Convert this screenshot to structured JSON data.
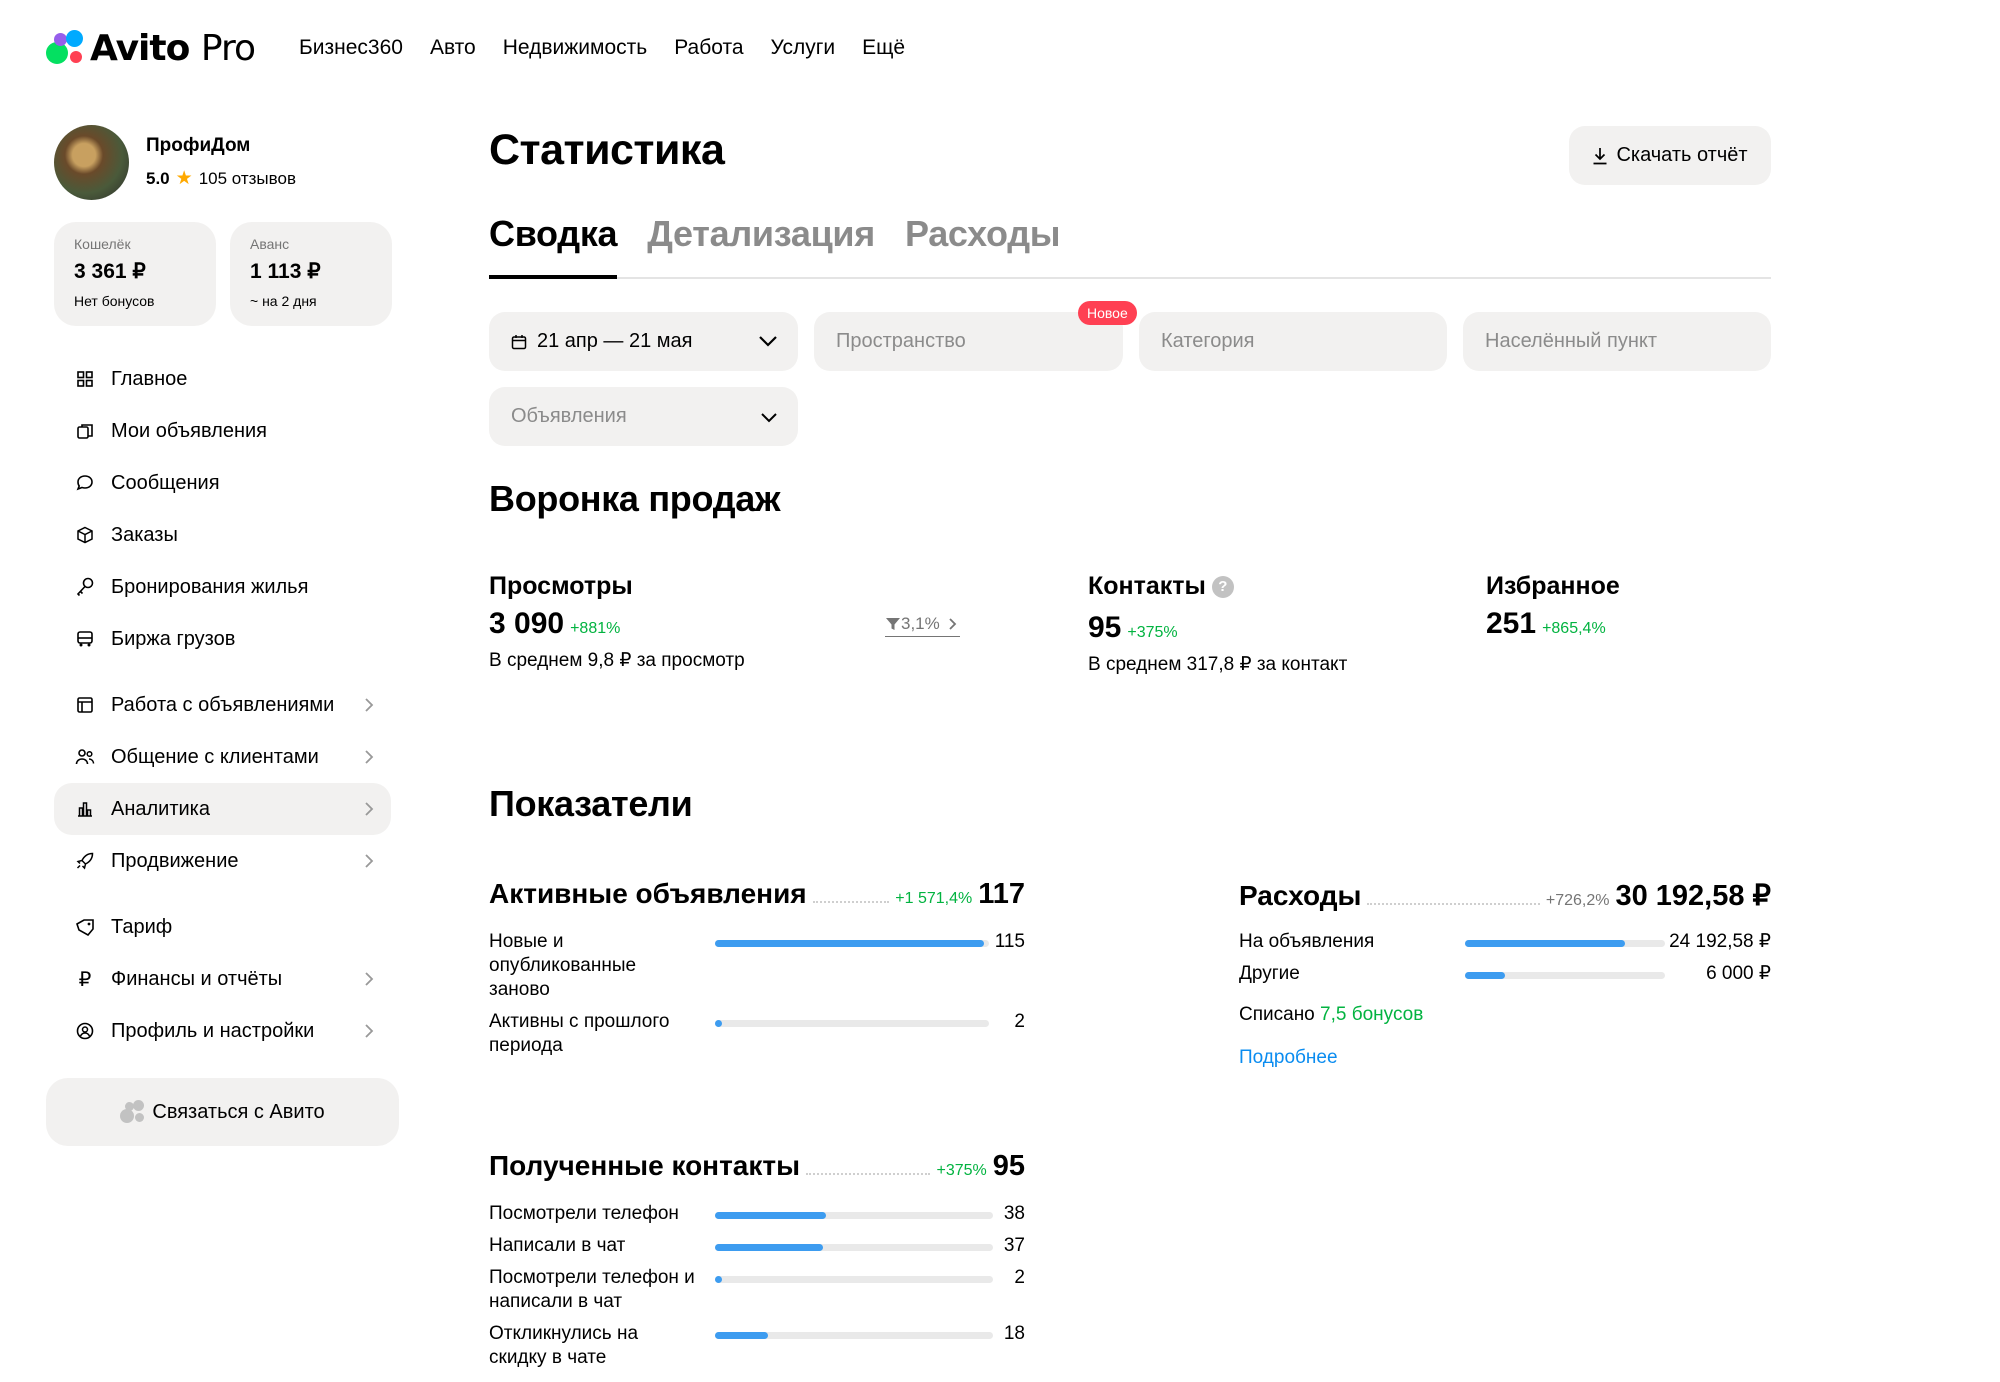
{
  "brand": {
    "name": "Avito",
    "suffix": "Pro"
  },
  "top_nav": [
    "Бизнес360",
    "Авто",
    "Недвижимость",
    "Работа",
    "Услуги",
    "Ещё"
  ],
  "profile": {
    "name": "ПрофиДом",
    "rating": "5.0",
    "reviews": "105 отзывов"
  },
  "wallets": [
    {
      "label": "Кошелёк",
      "value": "3 361 ₽",
      "sub": "Нет бонусов"
    },
    {
      "label": "Аванс",
      "value": "1 113 ₽",
      "sub": "~ на 2 дня"
    }
  ],
  "menu": [
    {
      "label": "Главное",
      "icon": "grid-icon"
    },
    {
      "label": "Мои объявления",
      "icon": "copy-icon"
    },
    {
      "label": "Сообщения",
      "icon": "chat-icon"
    },
    {
      "label": "Заказы",
      "icon": "box-icon"
    },
    {
      "label": "Бронирования жилья",
      "icon": "key-icon"
    },
    {
      "label": "Биржа грузов",
      "icon": "truck-icon"
    },
    {
      "label": "Работа с объявлениями",
      "icon": "list-icon",
      "chevron": true
    },
    {
      "label": "Общение с клиентами",
      "icon": "users-icon",
      "chevron": true
    },
    {
      "label": "Аналитика",
      "icon": "bar-chart-icon",
      "chevron": true,
      "active": true
    },
    {
      "label": "Продвижение",
      "icon": "rocket-icon",
      "chevron": true
    },
    {
      "label": "Тариф",
      "icon": "tag-icon"
    },
    {
      "label": "Финансы и отчёты",
      "icon": "ruble-icon",
      "chevron": true
    },
    {
      "label": "Профиль и настройки",
      "icon": "user-circle-icon",
      "chevron": true
    }
  ],
  "contact_button": "Связаться с Авито",
  "page": {
    "title": "Статистика",
    "download": "Скачать отчёт",
    "tabs": [
      "Сводка",
      "Детализация",
      "Расходы"
    ]
  },
  "filters": {
    "date": "21 апр — 21 мая",
    "space": "Пространство",
    "space_badge": "Новое",
    "category": "Категория",
    "location": "Населённый пункт",
    "ads": "Объявления"
  },
  "funnel": {
    "title": "Воронка продаж",
    "views": {
      "title": "Просмотры",
      "value": "3 090",
      "pct": "+881%",
      "sub": "В среднем 9,8 ₽ за просмотр"
    },
    "conversion": "3,1%",
    "contacts": {
      "title": "Контакты",
      "value": "95",
      "pct": "+375%",
      "sub": "В среднем 317,8 ₽ за контакт"
    },
    "favorites": {
      "title": "Избранное",
      "value": "251",
      "pct": "+865,4%"
    }
  },
  "indicators": {
    "title": "Показатели",
    "active_ads": {
      "title": "Активные объявления",
      "pct": "+1 571,4%",
      "value": "117",
      "rows": [
        {
          "label": "Новые и опубликованные заново",
          "value": "115",
          "ratio": 0.983
        },
        {
          "label": "Активны с прошлого периода",
          "value": "2",
          "ratio": 0.02
        }
      ]
    },
    "expenses": {
      "title": "Расходы",
      "pct": "+726,2%",
      "value": "30 192,58 ₽",
      "rows": [
        {
          "label": "На объявления",
          "value": "24 192,58 ₽",
          "ratio": 0.8
        },
        {
          "label": "Другие",
          "value": "6 000 ₽",
          "ratio": 0.2
        }
      ],
      "spent_prefix": "Списано",
      "spent_bonus": "7,5 бонусов",
      "more": "Подробнее"
    },
    "contacts": {
      "title": "Полученные контакты",
      "pct": "+375%",
      "value": "95",
      "rows": [
        {
          "label": "Посмотрели телефон",
          "value": "38",
          "ratio": 0.4
        },
        {
          "label": "Написали в чат",
          "value": "37",
          "ratio": 0.39
        },
        {
          "label": "Посмотрели телефон и написали в чат",
          "value": "2",
          "ratio": 0.025
        },
        {
          "label": "Откликнулись на скидку в чате",
          "value": "18",
          "ratio": 0.19
        }
      ]
    }
  }
}
